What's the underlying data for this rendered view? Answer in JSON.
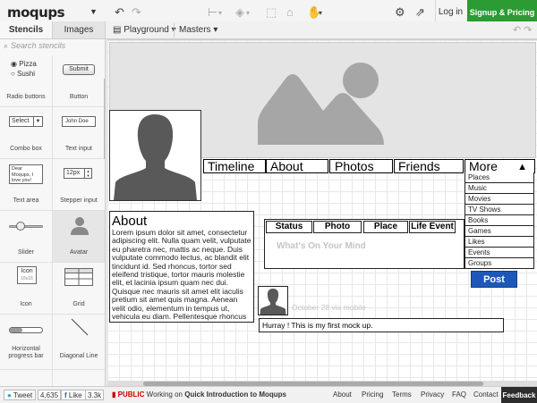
{
  "topbar": {
    "logo": "moqups",
    "login": "Log in",
    "signup": "Signup & Pricing",
    "brand_color": "#2c9b34"
  },
  "sidebar": {
    "tabs": [
      "Stencils",
      "Images"
    ],
    "search_placeholder": "Search stencils",
    "stencils": [
      {
        "label": "Radio buttons",
        "options": [
          "Pizza",
          "Sushi"
        ]
      },
      {
        "label": "Button",
        "preview": "Submit"
      },
      {
        "label": "Combo box",
        "preview": "Select"
      },
      {
        "label": "Text input",
        "preview": "John Doe"
      },
      {
        "label": "Text area",
        "preview": "Dear Moqups, I love you!"
      },
      {
        "label": "Stepper input",
        "preview": "12px"
      },
      {
        "label": "Slider"
      },
      {
        "label": "Avatar"
      },
      {
        "label": "Icon",
        "preview": "Icon",
        "sub": "16x16"
      },
      {
        "label": "Grid"
      },
      {
        "label": "Horizontal progress bar",
        "line1": "Horizontal",
        "line2": "progress bar"
      },
      {
        "label": "Diagonal Line"
      }
    ]
  },
  "projectbar": {
    "page": "Playground",
    "masters": "Masters"
  },
  "canvas": {
    "nav": [
      "Timeline",
      "About",
      "Photos",
      "Friends",
      "More"
    ],
    "more_items": [
      "Places",
      "Music",
      "Movies",
      "TV Shows",
      "Books",
      "Games",
      "Likes",
      "Events",
      "Groups"
    ],
    "about_title": "About",
    "about_text": "Lorem ipsum dolor sit amet, consectetur adipiscing elit. Nulla quam velit, vulputate eu pharetra nec, mattis ac neque. Duis vulputate commodo lectus, ac blandit elit tincidunt id. Sed rhoncus, tortor sed eleifend tristique, tortor mauris molestie elit, et lacinia ipsum quam nec dui. Quisque nec mauris sit amet elit iaculis pretium sit amet quis magna. Aenean velit odio, elementum in tempus ut, vehicula eu diam. Pellentesque rhoncus aliquam mattis. Ut vulputate eros sed felis sodales nec vulputate justo hendrerit. Vivamus",
    "status_tabs": [
      "Status",
      "Photo",
      "Place",
      "Life Event"
    ],
    "status_placeholder": "What's On Your Mind",
    "post": "Post",
    "post_date": "October 28 via mobile",
    "post_text": "Hurray ! This is my first mock up.",
    "post_color": "#1d58b9"
  },
  "bottombar": {
    "tweet": "Tweet",
    "tweet_count": "4,635",
    "like": "Like",
    "like_count": "3.3k",
    "public": "PUBLIC",
    "working_on": "Working on",
    "project": "Quick Introduction to Moqups",
    "links": [
      "About",
      "Pricing",
      "Terms",
      "Privacy",
      "FAQ",
      "Contact"
    ],
    "feedback": "Feedback"
  }
}
